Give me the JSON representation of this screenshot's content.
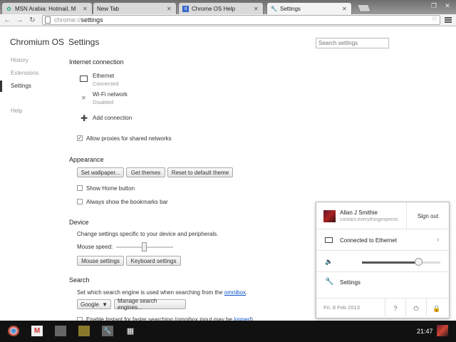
{
  "tabs": [
    {
      "title": "MSN Arabia: Hotmail, M",
      "icon": "msn-icon"
    },
    {
      "title": "New Tab",
      "icon": "none"
    },
    {
      "title": "Chrome OS Help",
      "icon": "google-icon"
    },
    {
      "title": "Settings",
      "icon": "wrench-icon",
      "active": true
    }
  ],
  "omnibox": {
    "scheme": "chrome://",
    "path": "settings"
  },
  "sidebar": {
    "title": "Chromium OS",
    "items": [
      "History",
      "Extensions",
      "Settings",
      "Help"
    ]
  },
  "page": {
    "title": "Settings",
    "search_placeholder": "Search settings"
  },
  "internet": {
    "heading": "Internet connection",
    "ethernet_name": "Ethernet",
    "ethernet_status": "Connected",
    "wifi_name": "Wi-Fi network",
    "wifi_status": "Disabled",
    "add_connection": "Add connection",
    "allow_proxies": "Allow proxies for shared networks",
    "allow_proxies_checked": true
  },
  "appearance": {
    "heading": "Appearance",
    "set_wallpaper": "Set wallpaper...",
    "get_themes": "Get themes",
    "reset_theme": "Reset to default theme",
    "show_home": "Show Home button",
    "show_bookmarks": "Always show the bookmarks bar"
  },
  "device": {
    "heading": "Device",
    "desc": "Change settings specific to your device and peripherals.",
    "mouse_speed": "Mouse speed:",
    "mouse_speed_level": 0.5,
    "mouse_settings": "Mouse settings",
    "keyboard_settings": "Keyboard settings"
  },
  "search": {
    "heading": "Search",
    "desc_prefix": "Set which search engine is used when searching from the ",
    "desc_link": "omnibox",
    "desc_suffix": ".",
    "engine": "Google",
    "manage": "Manage search engines...",
    "instant": "Enable Instant for faster searching (omnibox input may be ",
    "instant_link": "logged",
    "instant_suffix": ")"
  },
  "tray": {
    "user_name": "Allan J Smithie",
    "user_email": "contact.everythingexpress",
    "sign_out": "Sign out",
    "network": "Connected to Ethernet",
    "volume_level": 0.73,
    "settings": "Settings",
    "date": "Fri, 8 Feb 2013",
    "help": "?",
    "power_icon": "power-icon",
    "lock_icon": "lock-icon"
  },
  "shelf": {
    "items": [
      "chrome-icon",
      "gmail-icon",
      "app-icon",
      "app-icon",
      "wrench-icon",
      "app-launcher-icon"
    ],
    "clock": "21:47"
  }
}
